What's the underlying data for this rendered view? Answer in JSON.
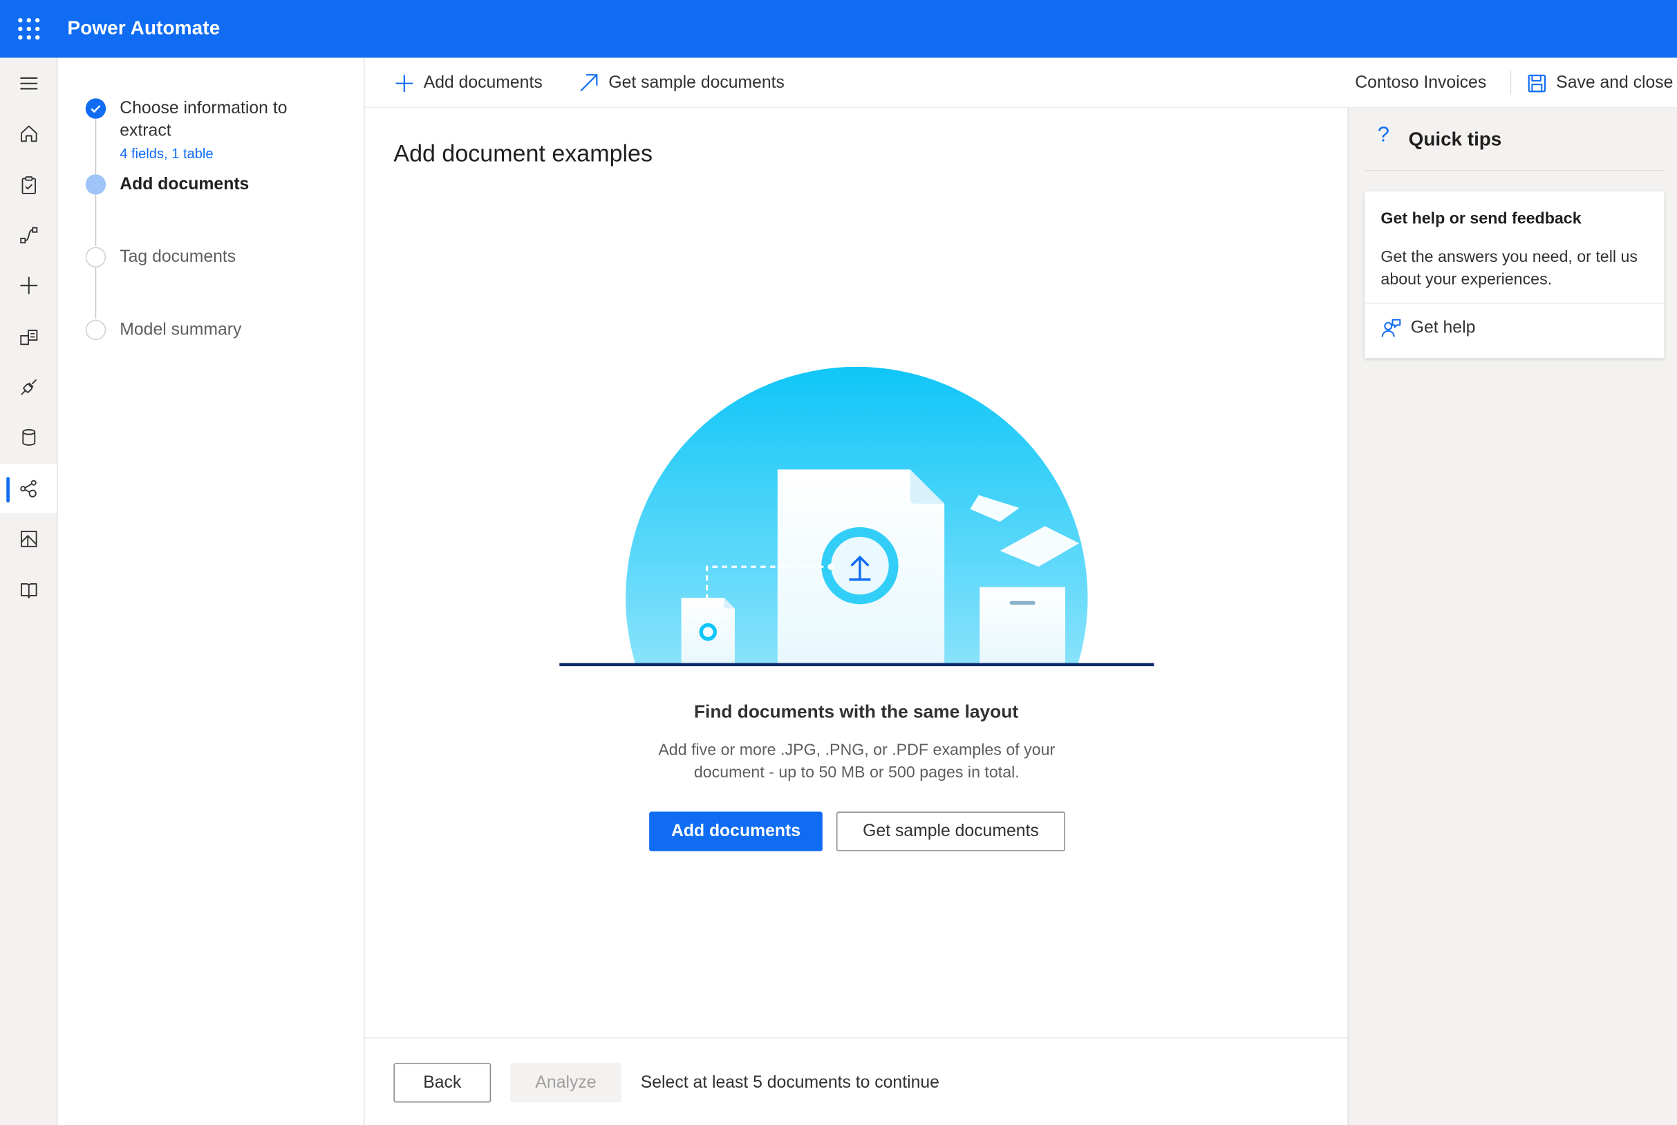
{
  "app": {
    "title": "Power Automate"
  },
  "rail": {
    "items": [
      {
        "icon": "hamburger-icon"
      },
      {
        "icon": "home-icon"
      },
      {
        "icon": "clipboard-check-icon"
      },
      {
        "icon": "flows-icon"
      },
      {
        "icon": "plus-icon"
      },
      {
        "icon": "templates-icon"
      },
      {
        "icon": "connectors-icon"
      },
      {
        "icon": "data-icon"
      },
      {
        "icon": "ai-models-icon",
        "active": true
      },
      {
        "icon": "process-mining-icon"
      },
      {
        "icon": "learn-book-icon"
      }
    ]
  },
  "steps": {
    "items": [
      {
        "label": "Choose information to extract",
        "sub": "4 fields, 1 table",
        "state": "done"
      },
      {
        "label": "Add documents",
        "state": "current"
      },
      {
        "label": "Tag documents",
        "state": "todo"
      },
      {
        "label": "Model summary",
        "state": "todo"
      }
    ]
  },
  "command_bar": {
    "add_documents": "Add documents",
    "get_sample_documents": "Get sample documents",
    "model_name": "Contoso Invoices",
    "save_and_close": "Save and close"
  },
  "main": {
    "title": "Add document examples",
    "empty_title": "Find documents with the same layout",
    "empty_description": "Add five or more .JPG, .PNG, or .PDF examples of your document - up to 50 MB or 500 pages in total.",
    "add_documents_button": "Add documents",
    "get_sample_button": "Get sample documents"
  },
  "footer": {
    "back_label": "Back",
    "analyze_label": "Analyze",
    "message": "Select at least 5 documents to continue"
  },
  "quick_tips": {
    "icon": "?",
    "title": "Quick tips",
    "card_title": "Get help or send feedback",
    "card_description": "Get the answers you need, or tell us about your experiences.",
    "get_help_label": "Get help"
  },
  "colors": {
    "brand": "#0f6cf3",
    "rail_background": "#f3f2f1",
    "step_current": "#9fc4f7",
    "illustration_cyan": "#16c8f5"
  }
}
